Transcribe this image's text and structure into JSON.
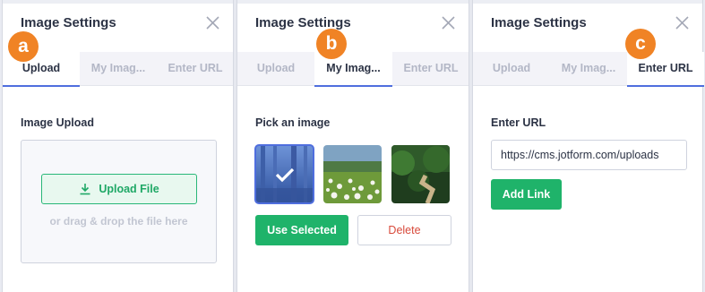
{
  "panels": {
    "a": {
      "badge": "a",
      "title": "Image Settings",
      "tabs": [
        "Upload",
        "My Imag...",
        "Enter URL"
      ],
      "active_tab": 0,
      "section_label": "Image Upload",
      "upload_button": "Upload File",
      "drop_text": "or drag & drop the file here"
    },
    "b": {
      "badge": "b",
      "title": "Image Settings",
      "tabs": [
        "Upload",
        "My Imag...",
        "Enter URL"
      ],
      "active_tab": 1,
      "section_label": "Pick an image",
      "images": [
        {
          "name": "forest-image",
          "selected": true
        },
        {
          "name": "flower-meadow-image",
          "selected": false
        },
        {
          "name": "forest-path-image",
          "selected": false
        }
      ],
      "use_selected_button": "Use Selected",
      "delete_button": "Delete"
    },
    "c": {
      "badge": "c",
      "title": "Image Settings",
      "tabs": [
        "Upload",
        "My Imag...",
        "Enter URL"
      ],
      "active_tab": 2,
      "section_label": "Enter URL",
      "url_value": "https://cms.jotform.com/uploads",
      "add_link_button": "Add Link"
    }
  },
  "colors": {
    "badge": "#f08325",
    "active_tab_underline": "#4f6ede",
    "primary_green": "#1fb36a",
    "delete_red": "#d84a3b"
  },
  "icons": {
    "close": "close-icon",
    "upload": "download-arrow-icon",
    "selected": "checkmark-icon"
  }
}
